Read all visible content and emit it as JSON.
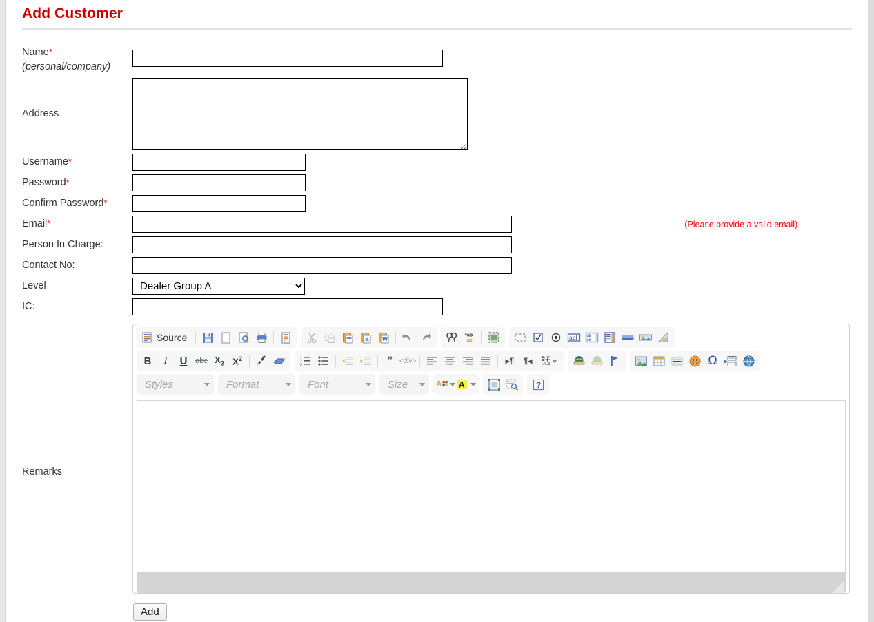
{
  "page": {
    "title": "Add Customer"
  },
  "form": {
    "fields": [
      {
        "label": "Name",
        "required": true,
        "sublabel": "(personal/company)",
        "type": "text",
        "value": "",
        "name": "name"
      },
      {
        "label": "Address",
        "required": false,
        "sublabel": "",
        "type": "textarea",
        "value": "",
        "name": "address"
      },
      {
        "label": "Username",
        "required": true,
        "sublabel": "",
        "type": "text",
        "value": "",
        "name": "username"
      },
      {
        "label": "Password",
        "required": true,
        "sublabel": "",
        "type": "password",
        "value": "",
        "name": "password"
      },
      {
        "label": "Confirm Password",
        "required": true,
        "sublabel": "",
        "type": "password",
        "value": "",
        "name": "confirm-password"
      },
      {
        "label": "Email",
        "required": true,
        "sublabel": "",
        "type": "text",
        "value": "",
        "name": "email",
        "hint": "(Please provide a valid email)"
      },
      {
        "label": "Person In Charge:",
        "required": false,
        "sublabel": "",
        "type": "text",
        "value": "",
        "name": "person-in-charge"
      },
      {
        "label": "Contact No:",
        "required": false,
        "sublabel": "",
        "type": "text",
        "value": "",
        "name": "contact-no"
      },
      {
        "label": "Level",
        "required": false,
        "sublabel": "",
        "type": "select",
        "value": "Dealer Group A",
        "name": "level"
      },
      {
        "label": "IC:",
        "required": false,
        "sublabel": "",
        "type": "text",
        "value": "",
        "name": "ic"
      },
      {
        "label": "Remarks",
        "required": false,
        "sublabel": "",
        "type": "richtext",
        "value": "",
        "name": "remarks"
      }
    ],
    "required_marker": "*",
    "email_hint": "(Please provide a valid email)",
    "level_options": [
      "Dealer Group A"
    ],
    "level_selected": "Dealer Group A",
    "submit_label": "Add"
  },
  "editor": {
    "content": "",
    "toolbar": {
      "row1": [
        {
          "group": "document",
          "buttons": [
            {
              "name": "source-icon",
              "label": "Source"
            },
            {
              "name": "save-icon",
              "label": ""
            },
            {
              "name": "new-page-icon",
              "label": ""
            },
            {
              "name": "preview-icon",
              "label": ""
            },
            {
              "name": "print-icon",
              "label": ""
            },
            {
              "name": "templates-icon",
              "label": ""
            }
          ]
        },
        {
          "group": "clipboard",
          "buttons": [
            {
              "name": "cut-icon",
              "label": ""
            },
            {
              "name": "copy-icon",
              "label": ""
            },
            {
              "name": "paste-icon",
              "label": ""
            },
            {
              "name": "paste-text-icon",
              "label": ""
            },
            {
              "name": "paste-from-word-icon",
              "label": ""
            },
            {
              "name": "undo-icon",
              "label": ""
            },
            {
              "name": "redo-icon",
              "label": ""
            }
          ]
        },
        {
          "group": "editing",
          "buttons": [
            {
              "name": "find-icon",
              "label": ""
            },
            {
              "name": "replace-icon",
              "label": ""
            },
            {
              "name": "select-all-icon",
              "label": ""
            }
          ]
        },
        {
          "group": "forms",
          "buttons": [
            {
              "name": "form-icon",
              "label": ""
            },
            {
              "name": "checkbox-icon",
              "label": ""
            },
            {
              "name": "radio-button-icon",
              "label": ""
            },
            {
              "name": "text-field-icon",
              "label": ""
            },
            {
              "name": "textarea-icon",
              "label": ""
            },
            {
              "name": "select-field-icon",
              "label": ""
            },
            {
              "name": "button-icon",
              "label": ""
            },
            {
              "name": "image-button-icon",
              "label": ""
            },
            {
              "name": "hidden-field-icon",
              "label": ""
            }
          ]
        }
      ],
      "row2": [
        {
          "group": "basic-styles",
          "buttons": [
            {
              "name": "bold-icon",
              "label": "B"
            },
            {
              "name": "italic-icon",
              "label": "I"
            },
            {
              "name": "underline-icon",
              "label": "U"
            },
            {
              "name": "strikethrough-icon",
              "label": "abc"
            },
            {
              "name": "subscript-icon",
              "label": "X2"
            },
            {
              "name": "superscript-icon",
              "label": "X2"
            },
            {
              "name": "copy-formatting-icon",
              "label": ""
            },
            {
              "name": "remove-format-icon",
              "label": ""
            }
          ]
        },
        {
          "group": "paragraph",
          "buttons": [
            {
              "name": "numbered-list-icon",
              "label": ""
            },
            {
              "name": "bulleted-list-icon",
              "label": ""
            },
            {
              "name": "decrease-indent-icon",
              "label": ""
            },
            {
              "name": "increase-indent-icon",
              "label": ""
            },
            {
              "name": "block-quote-icon",
              "label": ""
            },
            {
              "name": "create-div-icon",
              "label": ""
            },
            {
              "name": "align-left-icon",
              "label": ""
            },
            {
              "name": "align-center-icon",
              "label": ""
            },
            {
              "name": "align-right-icon",
              "label": ""
            },
            {
              "name": "justify-icon",
              "label": ""
            },
            {
              "name": "text-direction-ltr-icon",
              "label": ""
            },
            {
              "name": "text-direction-rtl-icon",
              "label": ""
            },
            {
              "name": "language-icon",
              "label": ""
            }
          ]
        },
        {
          "group": "links",
          "buttons": [
            {
              "name": "link-icon",
              "label": ""
            },
            {
              "name": "unlink-icon",
              "label": ""
            },
            {
              "name": "anchor-icon",
              "label": ""
            }
          ]
        },
        {
          "group": "insert",
          "buttons": [
            {
              "name": "image-icon",
              "label": ""
            },
            {
              "name": "table-icon",
              "label": ""
            },
            {
              "name": "horizontal-rule-icon",
              "label": ""
            },
            {
              "name": "smiley-icon",
              "label": ""
            },
            {
              "name": "special-character-icon",
              "label": ""
            },
            {
              "name": "page-break-icon",
              "label": ""
            },
            {
              "name": "iframe-icon",
              "label": ""
            }
          ]
        }
      ],
      "row3": {
        "styles_label": "Styles",
        "format_label": "Format",
        "font_label": "Font",
        "size_label": "Size",
        "buttons": [
          {
            "name": "text-color-icon",
            "label": "A"
          },
          {
            "name": "background-color-icon",
            "label": "A"
          },
          {
            "name": "maximize-icon",
            "label": ""
          },
          {
            "name": "show-blocks-icon",
            "label": ""
          },
          {
            "name": "about-icon",
            "label": "?"
          }
        ]
      }
    }
  },
  "colors": {
    "title": "#cc0000",
    "required": "#ff0000",
    "hint": "#ff0000",
    "rule": "#e3e3e3",
    "input_border": "#000000",
    "editor_chrome": "#f7f7f7"
  }
}
